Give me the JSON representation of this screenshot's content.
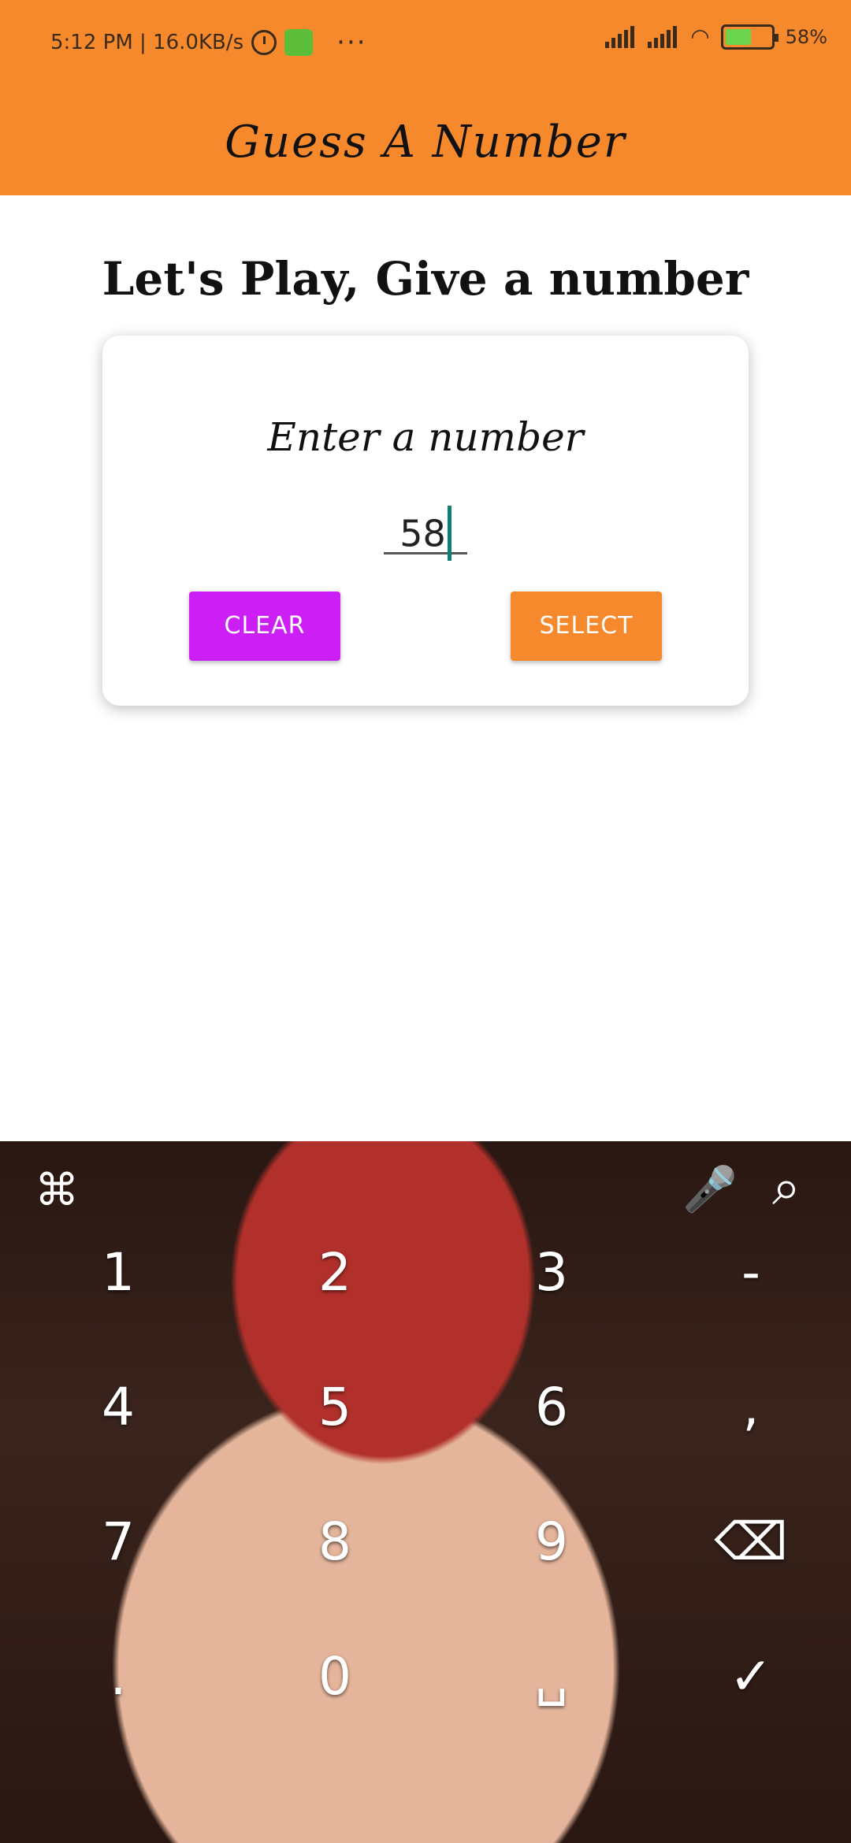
{
  "status_bar": {
    "time_speed": "5:12 PM | 16.0KB/s",
    "more": "···",
    "battery": "58%"
  },
  "app_bar": {
    "title": "Guess A Number"
  },
  "main": {
    "heading": "Let's Play, Give a number",
    "card": {
      "label": "Enter a number",
      "input_value": "58",
      "clear_label": "CLEAR",
      "select_label": "SELECT"
    }
  },
  "keyboard": {
    "toolbar": {
      "menu_icon": "⌘",
      "mic_icon": "🎤",
      "search_icon": "⌕"
    },
    "keys": [
      "1",
      "2",
      "3",
      "-",
      "4",
      "5",
      "6",
      ",",
      "7",
      "8",
      "9",
      "⌫",
      ".",
      "0",
      "␣",
      "✓"
    ]
  },
  "colors": {
    "accent": "#f5892c",
    "clear_button": "#cc1ff5",
    "cursor": "#0f7f6f"
  }
}
